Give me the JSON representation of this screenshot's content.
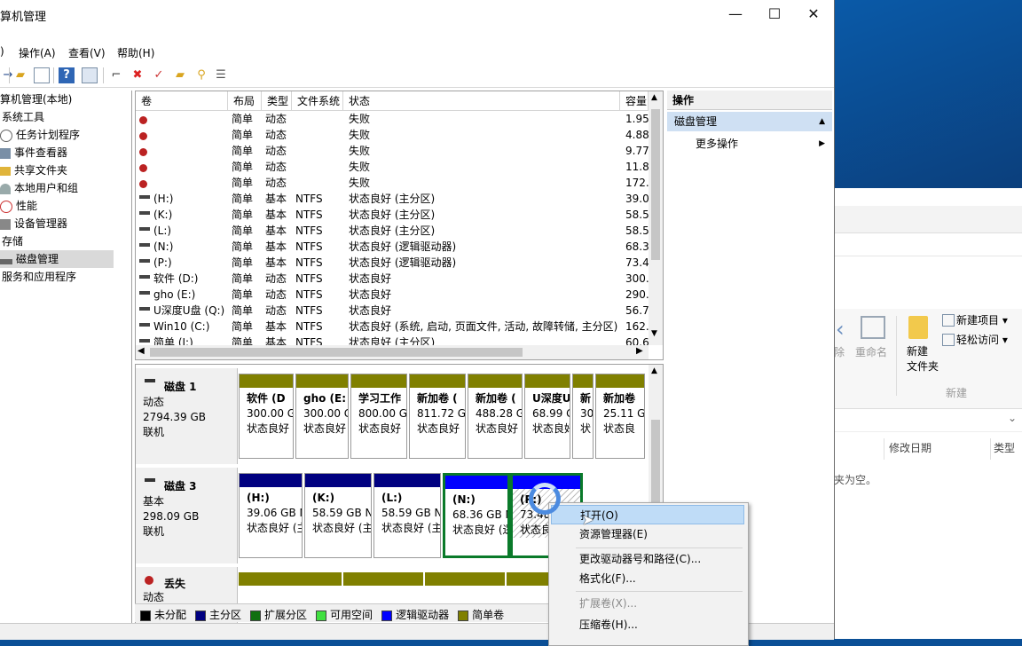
{
  "window": {
    "title": "算机管理"
  },
  "menu": [
    "操作(A)",
    "查看(V)",
    "帮助(H)"
  ],
  "tree": [
    {
      "label": "算机管理(本地)",
      "icon": "computer-icon"
    },
    {
      "label": "系统工具",
      "icon": "tools-icon"
    },
    {
      "label": "任务计划程序",
      "icon": "clock-icon"
    },
    {
      "label": "事件查看器",
      "icon": "event-viewer-icon"
    },
    {
      "label": "共享文件夹",
      "icon": "shared-folder-icon"
    },
    {
      "label": "本地用户和组",
      "icon": "users-icon"
    },
    {
      "label": "性能",
      "icon": "performance-icon"
    },
    {
      "label": "设备管理器",
      "icon": "device-manager-icon"
    },
    {
      "label": "存储",
      "icon": "storage-icon"
    },
    {
      "label": "磁盘管理",
      "icon": "disk-icon"
    },
    {
      "label": "服务和应用程序",
      "icon": "services-icon"
    }
  ],
  "volume_list": {
    "headers": [
      "卷",
      "布局",
      "类型",
      "文件系统",
      "状态",
      "容量"
    ],
    "rows": [
      {
        "vol": "",
        "layout": "简单",
        "type": "动态",
        "fs": "",
        "status": "失败",
        "cap": "1.95",
        "err": true
      },
      {
        "vol": "",
        "layout": "简单",
        "type": "动态",
        "fs": "",
        "status": "失败",
        "cap": "4.88",
        "err": true
      },
      {
        "vol": "",
        "layout": "简单",
        "type": "动态",
        "fs": "",
        "status": "失败",
        "cap": "9.77",
        "err": true
      },
      {
        "vol": "",
        "layout": "简单",
        "type": "动态",
        "fs": "",
        "status": "失败",
        "cap": "11.8",
        "err": true
      },
      {
        "vol": "",
        "layout": "简单",
        "type": "动态",
        "fs": "",
        "status": "失败",
        "cap": "172.",
        "err": true
      },
      {
        "vol": "(H:)",
        "layout": "简单",
        "type": "基本",
        "fs": "NTFS",
        "status": "状态良好 (主分区)",
        "cap": "39.0",
        "err": false
      },
      {
        "vol": "(K:)",
        "layout": "简单",
        "type": "基本",
        "fs": "NTFS",
        "status": "状态良好 (主分区)",
        "cap": "58.5",
        "err": false
      },
      {
        "vol": "(L:)",
        "layout": "简单",
        "type": "基本",
        "fs": "NTFS",
        "status": "状态良好 (主分区)",
        "cap": "58.5",
        "err": false
      },
      {
        "vol": "(N:)",
        "layout": "简单",
        "type": "基本",
        "fs": "NTFS",
        "status": "状态良好 (逻辑驱动器)",
        "cap": "68.3",
        "err": false
      },
      {
        "vol": "(P:)",
        "layout": "简单",
        "type": "基本",
        "fs": "NTFS",
        "status": "状态良好 (逻辑驱动器)",
        "cap": "73.4",
        "err": false
      },
      {
        "vol": "软件 (D:)",
        "layout": "简单",
        "type": "动态",
        "fs": "NTFS",
        "status": "状态良好",
        "cap": "300.",
        "err": false
      },
      {
        "vol": "gho (E:)",
        "layout": "简单",
        "type": "动态",
        "fs": "NTFS",
        "status": "状态良好",
        "cap": "290.",
        "err": false
      },
      {
        "vol": "U深度U盘 (Q:)",
        "layout": "简单",
        "type": "动态",
        "fs": "NTFS",
        "status": "状态良好",
        "cap": "56.7",
        "err": false
      },
      {
        "vol": "Win10 (C:)",
        "layout": "简单",
        "type": "基本",
        "fs": "NTFS",
        "status": "状态良好 (系统, 启动, 页面文件, 活动, 故障转储, 主分区)",
        "cap": "162.",
        "err": false
      },
      {
        "vol": "简单 (I:)",
        "layout": "简单",
        "type": "基本",
        "fs": "NTFS",
        "status": "状态良好 (主分区)",
        "cap": "60.6",
        "err": false
      }
    ]
  },
  "disks": [
    {
      "name": "磁盘 1",
      "type": "动态",
      "size": "2794.39 GB",
      "state": "联机",
      "parts": [
        {
          "name": "软件 (D",
          "size": "300.00 G",
          "status": "状态良好"
        },
        {
          "name": "gho (E:",
          "size": "300.00 G",
          "status": "状态良好"
        },
        {
          "name": "学习工作",
          "size": "800.00 G",
          "status": "状态良好"
        },
        {
          "name": "新加卷 (",
          "size": "811.72 G",
          "status": "状态良好"
        },
        {
          "name": "新加卷 (",
          "size": "488.28 G",
          "status": "状态良好"
        },
        {
          "name": "U深度U",
          "size": "68.99 G",
          "status": "状态良好"
        },
        {
          "name": "新",
          "size": "30",
          "status": "状"
        },
        {
          "name": "新加卷",
          "size": "25.11 G",
          "status": "状态良"
        }
      ]
    },
    {
      "name": "磁盘 3",
      "type": "基本",
      "size": "298.09 GB",
      "state": "联机",
      "parts": [
        {
          "name": "(H:)",
          "size": "39.06 GB N",
          "status": "状态良好 (主"
        },
        {
          "name": "(K:)",
          "size": "58.59 GB N",
          "status": "状态良好 (主"
        },
        {
          "name": "(L:)",
          "size": "58.59 GB N",
          "status": "状态良好 (主"
        },
        {
          "name": "(N:)",
          "size": "68.36 GB N",
          "status": "状态良好 (逻"
        },
        {
          "name": "(P:)",
          "size": "73.48",
          "status": "状态良"
        }
      ]
    },
    {
      "name": "丢失",
      "type": "动态",
      "size": "",
      "state": ""
    }
  ],
  "legend": [
    "未分配",
    "主分区",
    "扩展分区",
    "可用空间",
    "逻辑驱动器",
    "简单卷"
  ],
  "legend_colors": [
    "#000000",
    "#000080",
    "#107010",
    "#40e040",
    "#0000ff",
    "#808000"
  ],
  "actions": {
    "header": "操作",
    "section": "磁盘管理",
    "more": "更多操作"
  },
  "context_menu": [
    {
      "label": "打开(O)",
      "enabled": true,
      "highlight": true
    },
    {
      "label": "资源管理器(E)",
      "enabled": true
    },
    {
      "label": "更改驱动器号和路径(C)...",
      "enabled": true
    },
    {
      "label": "格式化(F)...",
      "enabled": true
    },
    {
      "label": "扩展卷(X)...",
      "enabled": false
    },
    {
      "label": "压缩卷(H)...",
      "enabled": true
    }
  ],
  "explorer": {
    "back_label": "除",
    "rename_label": "重命名",
    "new_folder": "新建\n文件夹",
    "new_item": "新建项目",
    "easy_access": "轻松访问",
    "group_new": "新建",
    "col_modified": "修改日期",
    "col_type": "类型",
    "empty_text": "夹为空。"
  }
}
